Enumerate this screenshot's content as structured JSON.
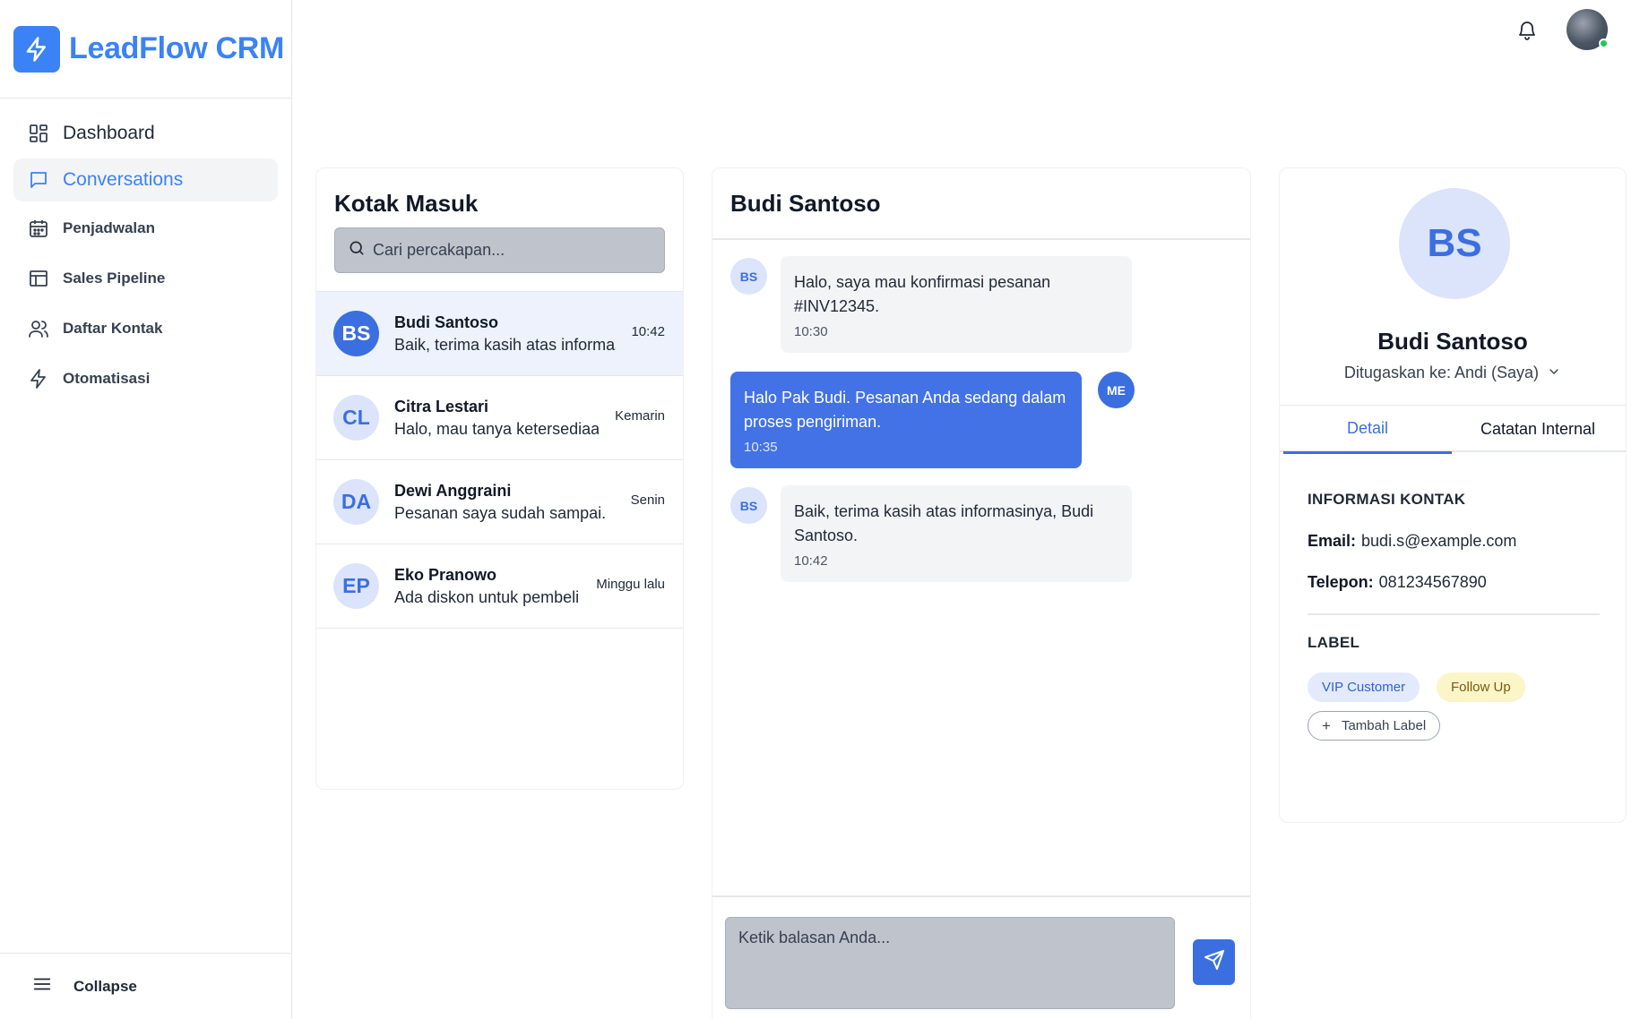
{
  "app": {
    "brand": "LeadFlow CRM",
    "brand_color": "#3b82f6"
  },
  "sidebar": {
    "items": [
      {
        "label": "Dashboard",
        "icon": "grid-icon"
      },
      {
        "label": "Conversations",
        "icon": "chat-icon",
        "active": true
      },
      {
        "label": "Penjadwalan",
        "icon": "calendar-icon"
      },
      {
        "label": "Sales Pipeline",
        "icon": "table-icon"
      },
      {
        "label": "Daftar Kontak",
        "icon": "users-icon"
      },
      {
        "label": "Otomatisasi",
        "icon": "lightning-icon"
      }
    ],
    "collapse_label": "Collapse"
  },
  "inbox": {
    "title": "Kotak Masuk",
    "search_placeholder": "Cari percakapan...",
    "conversations": [
      {
        "initials": "BS",
        "name": "Budi Santoso",
        "snippet": "Baik, terima kasih atas informasinya, Budi Santoso.",
        "time": "10:42"
      },
      {
        "initials": "CL",
        "name": "Citra Lestari",
        "snippet": "Halo, mau tanya ketersediaan",
        "time": "Kemarin"
      },
      {
        "initials": "DA",
        "name": "Dewi Anggraini",
        "snippet": "Pesanan saya sudah sampai.",
        "time": "Senin"
      },
      {
        "initials": "EP",
        "name": "Eko Pranowo",
        "snippet": "Ada diskon untuk pembelian",
        "time": "Minggu lalu"
      }
    ]
  },
  "chat": {
    "title": "Budi Santoso",
    "messages": [
      {
        "from": "in",
        "avatar": "BS",
        "text": "Halo, saya mau konfirmasi pesanan #INV12345.",
        "time": "10:30"
      },
      {
        "from": "out",
        "avatar": "ME",
        "text": "Halo Pak Budi. Pesanan Anda sedang dalam proses pengiriman.",
        "time": "10:35"
      },
      {
        "from": "in",
        "avatar": "BS",
        "text": "Baik, terima kasih atas informasinya, Budi Santoso.",
        "time": "10:42"
      }
    ],
    "reply_placeholder": "Ketik balasan Anda..."
  },
  "contact": {
    "initials": "BS",
    "name": "Budi Santoso",
    "assigned": "Ditugaskan ke: Andi (Saya)",
    "tabs": [
      "Detail",
      "Catatan Internal"
    ],
    "info_heading": "INFORMASI KONTAK",
    "email_label": "Email:",
    "email": "budi.s@example.com",
    "phone_label": "Telepon:",
    "phone": "081234567890",
    "label_heading": "LABEL",
    "labels": [
      "VIP Customer",
      "Follow Up"
    ],
    "add_label": "Tambah Label"
  }
}
